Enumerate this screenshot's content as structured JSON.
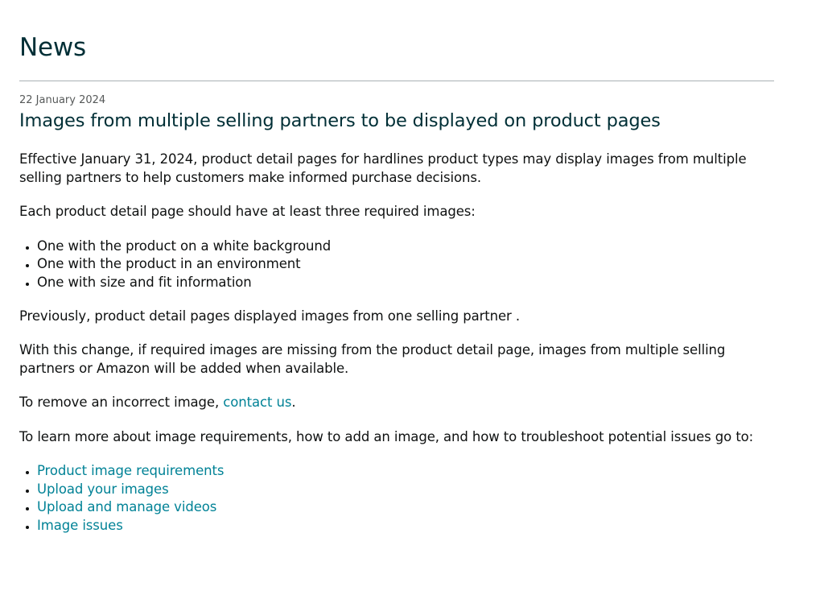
{
  "page": {
    "title": "News"
  },
  "article": {
    "date": "22 January 2024",
    "title": "Images from multiple selling partners to be displayed on product pages",
    "paragraph_effective": "Effective January 31, 2024, product detail pages for hardlines product types may display images from multiple selling partners to help customers make informed purchase decisions.",
    "paragraph_required": "Each product detail page should have at least three required images:",
    "required_images": [
      "One with the product on a white background",
      "One with the product in an environment",
      "One with size and fit information"
    ],
    "paragraph_previously": "Previously, product detail pages displayed images from one selling partner .",
    "paragraph_change": "With this change, if required images are missing from the product detail page, images from multiple selling partners or Amazon will be added when available.",
    "remove_prefix": "To remove an incorrect image, ",
    "remove_link": "contact us",
    "remove_suffix": ".",
    "paragraph_learn": "To learn more about image requirements, how to add an image, and how to troubleshoot potential issues go to:",
    "resource_links": [
      "Product image requirements",
      "Upload your images",
      "Upload and manage videos",
      "Image issues"
    ]
  },
  "colors": {
    "heading": "#002f36",
    "link": "#008296",
    "text": "#0f1111",
    "muted": "#565959",
    "divider": "#aab0b4"
  }
}
